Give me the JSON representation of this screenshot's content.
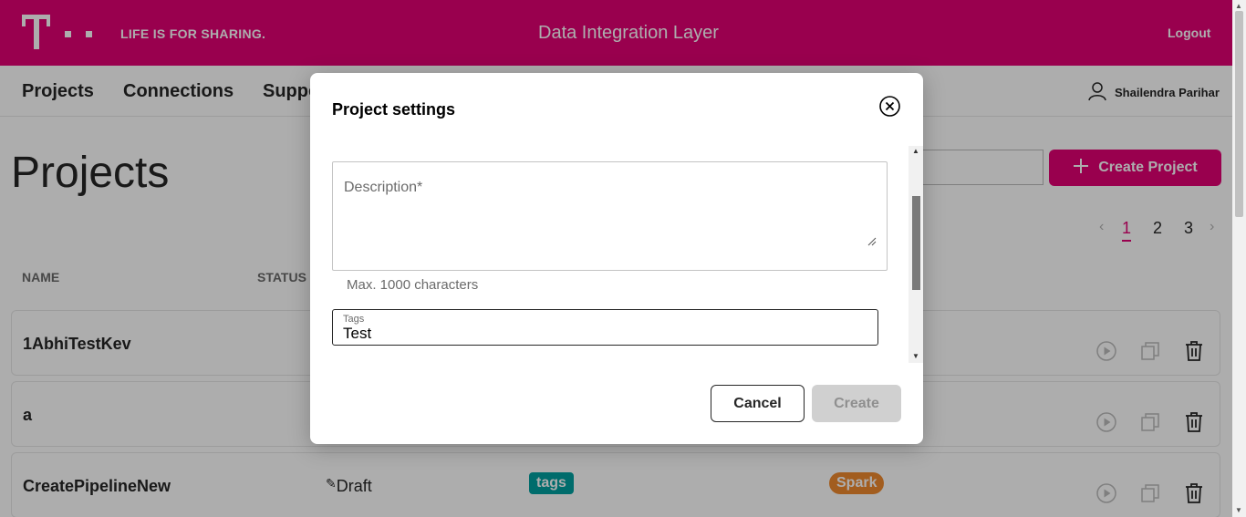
{
  "header": {
    "slogan": "LIFE IS FOR SHARING.",
    "app_title": "Data Integration Layer",
    "logout_label": "Logout",
    "brand_color": "#e20074"
  },
  "nav": {
    "items": [
      {
        "label": "Projects"
      },
      {
        "label": "Connections"
      },
      {
        "label": "Suppo"
      }
    ],
    "user_name": "Shailendra Parihar"
  },
  "page": {
    "title": "Projects",
    "create_button_label": "Create Project",
    "pagination": {
      "pages": [
        "1",
        "2",
        "3"
      ],
      "current": "1"
    }
  },
  "table": {
    "columns": [
      "NAME",
      "STATUS"
    ],
    "rows": [
      {
        "name": "1AbhiTestKev",
        "status": "",
        "tag": "",
        "engine": ""
      },
      {
        "name": "a",
        "status": "",
        "tag": "",
        "engine": ""
      },
      {
        "name": "CreatePipelineNew",
        "status": "Draft",
        "tag": "tags",
        "engine": "Spark"
      }
    ]
  },
  "modal": {
    "title": "Project settings",
    "description_label": "Description*",
    "description_value": "",
    "description_hint": "Max. 1000 characters",
    "tags_label": "Tags",
    "tags_value": "Test",
    "cancel_label": "Cancel",
    "create_label": "Create",
    "create_enabled": false
  }
}
